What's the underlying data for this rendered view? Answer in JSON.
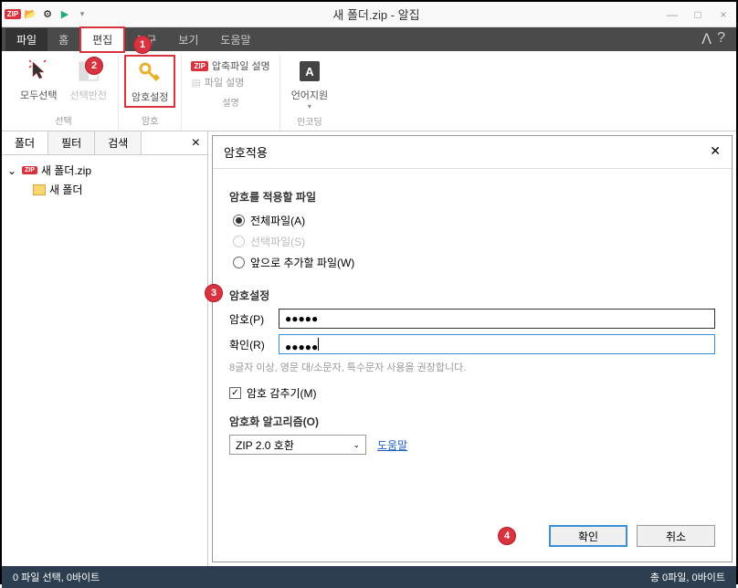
{
  "window": {
    "title": "새 폴더.zip - 알집",
    "min": "—",
    "max": "□",
    "close": "×"
  },
  "menu": {
    "file": "파일",
    "home": "홈",
    "edit": "편집",
    "tools": "도구",
    "view": "보기",
    "help": "도움말"
  },
  "ribbon": {
    "select_all": "모두선택",
    "select_invert": "선택반전",
    "password_set": "암호설정",
    "zip_comment": "압축파일 설명",
    "file_comment": "파일 설명",
    "lang_support": "언어지원",
    "group_select": "선택",
    "group_password": "암호",
    "group_comment": "설명",
    "group_encoding": "인코딩"
  },
  "sidebar": {
    "tabs": {
      "folder": "폴더",
      "filter": "필터",
      "search": "검색"
    },
    "tree": {
      "root": "새 폴더.zip",
      "child": "새 폴더"
    }
  },
  "dialog": {
    "title": "암호적용",
    "section_files": "암호를 적용할 파일",
    "radio_all": "전체파일(A)",
    "radio_selected": "선택파일(S)",
    "radio_future": "앞으로 추가할 파일(W)",
    "section_password": "암호설정",
    "label_password": "암호(P)",
    "label_confirm": "확인(R)",
    "pw_value": "●●●●●",
    "confirm_value": "●●●●●",
    "hint": "8글자 이상, 영문 대/소문자, 특수문자 사용을 권장합니다.",
    "hide_password": "암호 감추기(M)",
    "section_algorithm": "암호화 알고리즘(O)",
    "algorithm_value": "ZIP 2.0 호환",
    "help_link": "도움말",
    "ok": "확인",
    "cancel": "취소"
  },
  "statusbar": {
    "left": "0 파일 선택, 0바이트",
    "right": "총 0파일, 0바이트"
  },
  "callouts": {
    "c1": "1",
    "c2": "2",
    "c3": "3",
    "c4": "4"
  }
}
